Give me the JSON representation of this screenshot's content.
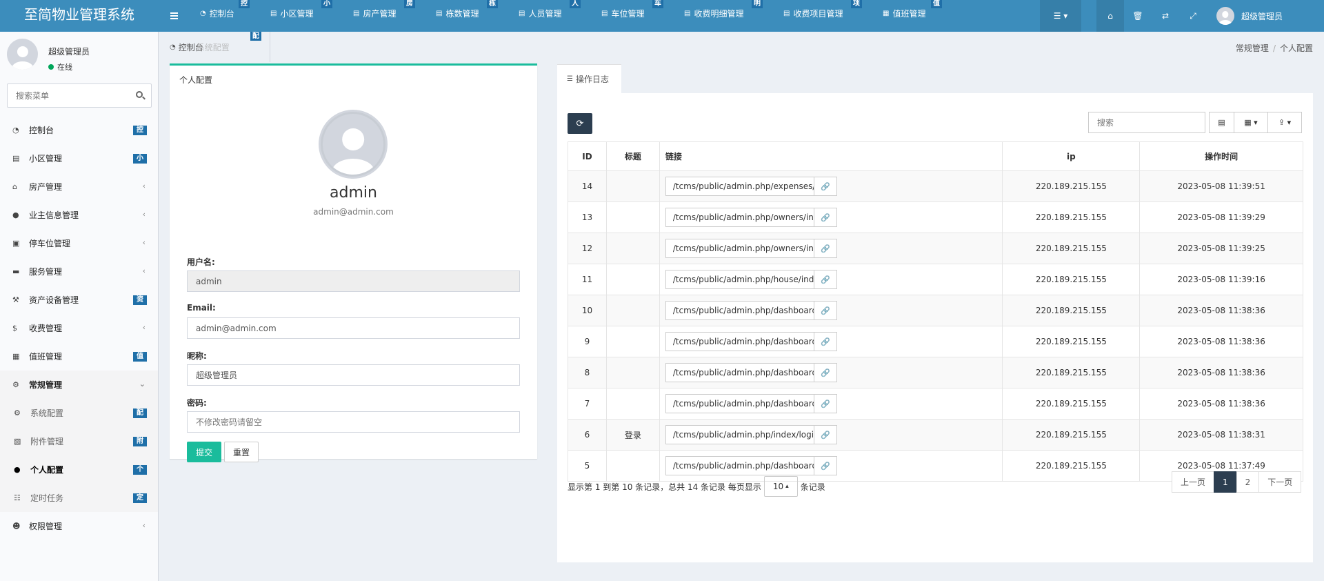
{
  "app": {
    "title": "至简物业管理系统"
  },
  "topnav": [
    {
      "label": "控制台",
      "badge": "控",
      "icon": "dashboard-icon"
    },
    {
      "label": "小区管理",
      "badge": "小",
      "icon": "list-icon"
    },
    {
      "label": "房产管理",
      "badge": "房",
      "icon": "list-icon"
    },
    {
      "label": "栋数管理",
      "badge": "栋",
      "icon": "list-icon"
    },
    {
      "label": "人员管理",
      "badge": "人",
      "icon": "list-icon"
    },
    {
      "label": "车位管理",
      "badge": "车",
      "icon": "list-icon"
    },
    {
      "label": "收费明细管理",
      "badge": "明",
      "icon": "list-icon"
    },
    {
      "label": "收费项目管理",
      "badge": "项",
      "icon": "list-icon"
    },
    {
      "label": "值班管理",
      "badge": "值",
      "icon": "calendar-icon"
    }
  ],
  "topright": {
    "username": "超级管理员"
  },
  "sidebar": {
    "user": {
      "name": "超级管理员",
      "status": "在线"
    },
    "search_placeholder": "搜索菜单",
    "items": [
      {
        "label": "控制台",
        "badge": "控",
        "icon": "dashboard-icon"
      },
      {
        "label": "小区管理",
        "badge": "小",
        "icon": "list-icon"
      },
      {
        "label": "房产管理",
        "arrow": "‹",
        "icon": "home-icon"
      },
      {
        "label": "业主信息管理",
        "arrow": "‹",
        "icon": "user-icon"
      },
      {
        "label": "停车位管理",
        "arrow": "‹",
        "icon": "film-icon"
      },
      {
        "label": "服务管理",
        "arrow": "‹",
        "icon": "coffee-icon"
      },
      {
        "label": "资产设备管理",
        "badge": "资",
        "icon": "gavel-icon"
      },
      {
        "label": "收费管理",
        "arrow": "‹",
        "icon": "dollar-icon"
      },
      {
        "label": "值班管理",
        "badge": "值",
        "icon": "calendar-icon"
      },
      {
        "label": "常规管理",
        "arrow": "⌄",
        "icon": "cogs-icon"
      },
      {
        "label": "系统配置",
        "badge": "配",
        "icon": "gear-icon"
      },
      {
        "label": "附件管理",
        "badge": "附",
        "icon": "image-icon"
      },
      {
        "label": "个人配置",
        "badge": "个",
        "icon": "user-icon"
      },
      {
        "label": "定时任务",
        "badge": "定",
        "icon": "tasks-icon"
      },
      {
        "label": "权限管理",
        "arrow": "‹",
        "icon": "group-icon"
      }
    ]
  },
  "tabs": {
    "dashboard": "控制台",
    "system_config": "系统配置",
    "badge": "配"
  },
  "breadcrumb": [
    "常规管理",
    "个人配置"
  ],
  "profile": {
    "header": "个人配置",
    "username": "admin",
    "email": "admin@admin.com",
    "labels": {
      "username": "用户名:",
      "email": "Email:",
      "nickname": "昵称:",
      "password": "密码:"
    },
    "values": {
      "username": "admin",
      "email": "admin@admin.com",
      "nickname": "超级管理员"
    },
    "password_placeholder": "不修改密码请留空",
    "submit": "提交",
    "reset": "重置"
  },
  "log": {
    "tab": "操作日志",
    "search_placeholder": "搜索",
    "columns": [
      "ID",
      "标题",
      "链接",
      "ip",
      "操作时间"
    ],
    "rows": [
      {
        "id": "14",
        "title": "",
        "url": "/tcms/public/admin.php/expenses/index",
        "ip": "220.189.215.155",
        "time": "2023-05-08 11:39:51"
      },
      {
        "id": "13",
        "title": "",
        "url": "/tcms/public/admin.php/owners/index",
        "ip": "220.189.215.155",
        "time": "2023-05-08 11:39:29"
      },
      {
        "id": "12",
        "title": "",
        "url": "/tcms/public/admin.php/owners/index",
        "ip": "220.189.215.155",
        "time": "2023-05-08 11:39:25"
      },
      {
        "id": "11",
        "title": "",
        "url": "/tcms/public/admin.php/house/index/",
        "ip": "220.189.215.155",
        "time": "2023-05-08 11:39:16"
      },
      {
        "id": "10",
        "title": "",
        "url": "/tcms/public/admin.php/dashboard/get",
        "ip": "220.189.215.155",
        "time": "2023-05-08 11:38:36"
      },
      {
        "id": "9",
        "title": "",
        "url": "/tcms/public/admin.php/dashboard/get",
        "ip": "220.189.215.155",
        "time": "2023-05-08 11:38:36"
      },
      {
        "id": "8",
        "title": "",
        "url": "/tcms/public/admin.php/dashboard/get",
        "ip": "220.189.215.155",
        "time": "2023-05-08 11:38:36"
      },
      {
        "id": "7",
        "title": "",
        "url": "/tcms/public/admin.php/dashboard/get",
        "ip": "220.189.215.155",
        "time": "2023-05-08 11:38:36"
      },
      {
        "id": "6",
        "title": "登录",
        "url": "/tcms/public/admin.php/index/login?u",
        "ip": "220.189.215.155",
        "time": "2023-05-08 11:38:31"
      },
      {
        "id": "5",
        "title": "",
        "url": "/tcms/public/admin.php/dashboard/get",
        "ip": "220.189.215.155",
        "time": "2023-05-08 11:37:49"
      }
    ],
    "pagination": {
      "info_before": "显示第 1 到第 10 条记录，总共 14 条记录 每页显示",
      "page_size": "10",
      "info_after": "条记录",
      "prev": "上一页",
      "pages": [
        "1",
        "2"
      ],
      "next": "下一页"
    }
  }
}
